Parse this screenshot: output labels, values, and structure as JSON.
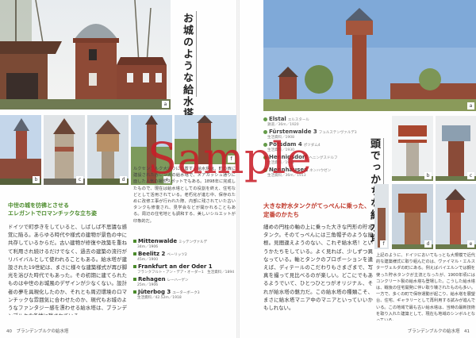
{
  "left_page": {
    "title": "お城のような給水塔",
    "section_heading": "中世の城を彷彿とさせる\nエレガントでロマンチックな立ち姿",
    "body": "ドイツで町歩きをしていると、しばしば不思議な感覚に陥る。あらゆる時代や様式の建物が景色の中に共存しているからだ。古い建物が修復や改築を重ねて利用され続けるだけでなく、過去の建築の流行がリバイバルとして使われることもある。給水塔が建設された19世紀は、まさに様々な建築様式が再び脚光を浴びた時代でもあった。その初期に建てられたものは中世のお城風のデザインが少なくない。設計者の夢を具現化したのか、それとも周辺環境のロマンチックな雰囲気に合わせたのか、現代もお城のようなファンタジー感を漂わせる給水塔は、ブランデンブルクの各地に残されている。",
    "caption_text": "ルクセンブルク大通りに位置する給水塔は、町の西に建設された赤レンガの給水塔で、メアカッシュ通りに面した人気の撮影スポットでもある。1898年に完成したもので、現在は給水塔としての役割を終え、住宅などとして活用されている。老朽化が進む中、保存のために改修工事が行われた際、内部に残されていた古いタンクも修復され、見学会などが開かれることもある。周辺の住宅地とも調和する、美しいシルエットが印象的だ。",
    "locations": [
      {
        "name": "Mittenwalde",
        "kana": "ミッテンヴァルデ",
        "info": "34m／1906"
      },
      {
        "name": "Beelitz 2",
        "kana": "ベーリッツ2",
        "info": "45m／1900"
      },
      {
        "name": "Frankfurt an der Oder 1",
        "kana": "フランクフルト・アン・デア・オーダー1",
        "info": "生活資料／1894"
      },
      {
        "name": "Rehagen",
        "kana": "レーハーゲン",
        "info": "25m／1906"
      },
      {
        "name": "Jüterbog 3",
        "kana": "ユーターボーク3",
        "info": "生活資料／42.52m／1918"
      }
    ],
    "photo_tags": [
      "a",
      "b",
      "c",
      "d",
      "e",
      "f"
    ],
    "footer": "40　ブランデンブルクの給水塔"
  },
  "right_page": {
    "title": "頭でっかちな給水塔",
    "section_heading": "大きな貯水タンクがてっぺんに乗った、\n定番のかたち",
    "body": "細めの円柱の軸の上に乗った大きな円形の貯水タンク。そのてっぺんには三角帽子のような屋根。見間違えようのない、これぞ給水塔！というかたちをしている。よく見れば、少しずつ異なっている。軸とタンクのプロポーションを違えば、ディテールのこだわりもさまざまで、写真を撮って見比べるのが楽しい。どこにでもあるようでいて、ひとつひとつがオリジナル、それが給水塔の魅力だ。この給水塔の種類こそ、まさに給水塔マニア中のマニアといっていいかもしれない。",
    "note": "上記のように、ドイツにおいてもっとも大規模で近代的な建築様式に取り組んだのは、ヴァイマル・エルスターヴェルダの町にある。例えばバイエルンでは鋼を使った貯水タンクが主流となったが、1900年頃にはコンクリート製の給水塔も登場した。こうした給水塔は、戦後の住宅開発に伴い取り壊されたものも多い。一方で、多くの町で保存運動が起こり、給水塔を展望台、住宅、ギャラリーとして再利用する試みが進んでいる。この地域で最も古い給水塔は、当時の最新技術を取り入れた建築として、現在も地域のシンボルとなっている。",
    "locations": [
      {
        "name": "Elstal",
        "kana": "エルスタール",
        "info": "鉄道／36m／1920"
      },
      {
        "name": "Fürstenwalde 3",
        "kana": "フュルステンヴァルデ3",
        "info": "生活資料／1908"
      },
      {
        "name": "Potsdam 4",
        "kana": "ポツダム4",
        "info": "生活資料／1930"
      },
      {
        "name": "Hennigsdorf",
        "kana": "ヘニングスドルフ",
        "info": "生活資料／1901"
      },
      {
        "name": "Nennhausen",
        "kana": "ネンハウゼン",
        "info": "生活資料／36m／1913"
      }
    ],
    "photo_tags": [
      "a",
      "b",
      "c",
      "d",
      "e",
      "f"
    ],
    "footer": "ブランデンブルクの給水塔　41"
  },
  "watermark": "Sample",
  "colors": {
    "accent_green": "#4a8a2a",
    "accent_red": "#c0392b",
    "watermark": "#c81e28"
  }
}
